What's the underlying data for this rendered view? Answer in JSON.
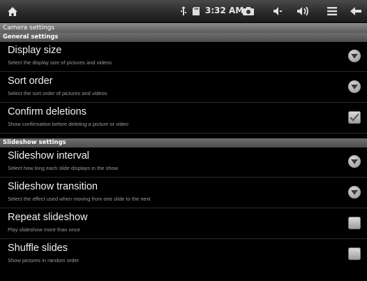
{
  "status_bar": {
    "time": "3:32 AM",
    "icons": [
      "home-icon",
      "usb-icon",
      "sd-card-icon",
      "camera-icon",
      "volume-down-icon",
      "volume-up-icon",
      "menu-icon",
      "back-icon"
    ]
  },
  "title": "Camera settings",
  "sections": [
    {
      "header": "General settings",
      "items": [
        {
          "title": "Display size",
          "subtitle": "Select the display size of pictures and videos",
          "control": "chevron"
        },
        {
          "title": "Sort order",
          "subtitle": "Select the sort order of pictures and videos",
          "control": "chevron"
        },
        {
          "title": "Confirm deletions",
          "subtitle": "Show confirmation before deleting a picture or video",
          "control": "checkbox",
          "checked": true
        }
      ]
    },
    {
      "header": "Slideshow settings",
      "items": [
        {
          "title": "Slideshow interval",
          "subtitle": "Select how long each slide displays in the show",
          "control": "chevron"
        },
        {
          "title": "Slideshow transition",
          "subtitle": "Select the effect used when moving from one slide to the next",
          "control": "chevron"
        },
        {
          "title": "Repeat slideshow",
          "subtitle": "Play slideshow more than once",
          "control": "checkbox",
          "checked": false
        },
        {
          "title": "Shuffle slides",
          "subtitle": "Show pictures in random order",
          "control": "checkbox",
          "checked": false
        }
      ]
    }
  ]
}
